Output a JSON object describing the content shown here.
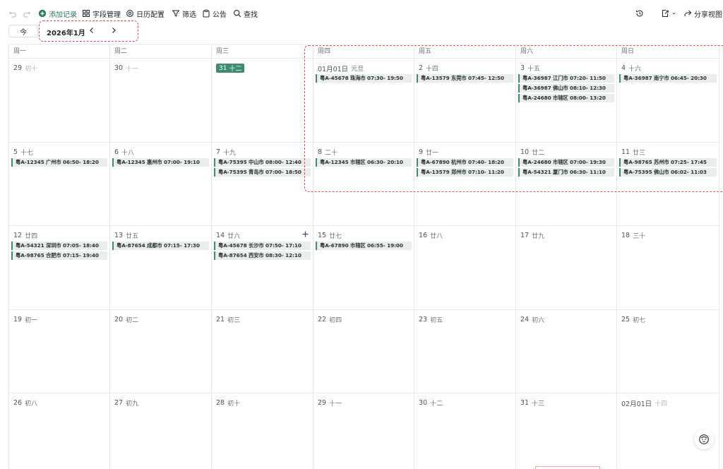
{
  "toolbar": {
    "add_record": "添加记录",
    "field_manage": "字段管理",
    "calendar_config": "日历配置",
    "filter": "筛选",
    "notice": "公告",
    "find": "查找",
    "share_view": "分享视图",
    "accent_color": "#2f7a62"
  },
  "subbar": {
    "today": "今",
    "month": "2026年1月"
  },
  "weekdays": [
    "周一",
    "周二",
    "周三",
    "周四",
    "周五",
    "周六",
    "周日"
  ],
  "weeks": [
    [
      {
        "num": "29",
        "lunar": "初十",
        "dim": true,
        "events": []
      },
      {
        "num": "30",
        "lunar": "十一",
        "dim": true,
        "events": []
      },
      {
        "num": "31",
        "lunar": "十二",
        "today": true,
        "events": []
      },
      {
        "num": "01月01日",
        "lunar": "元旦",
        "events": [
          "粤A-45678 珠海市 07:30- 19:50"
        ]
      },
      {
        "num": "2",
        "lunar": "十四",
        "events": [
          "粤A-13579 东莞市 07:45- 12:50"
        ]
      },
      {
        "num": "3",
        "lunar": "十五",
        "events": [
          "粤A-36987 江门市 07:20- 11:50",
          "粤A-36987 佛山市 08:10- 12:30",
          "粤A-24680 市辖区 08:00- 13:20"
        ]
      },
      {
        "num": "4",
        "lunar": "十六",
        "events": [
          "粤A-36987 南宁市 06:45- 20:30"
        ]
      }
    ],
    [
      {
        "num": "5",
        "lunar": "十七",
        "events": [
          "粤A-12345 广州市 06:50- 18:20"
        ]
      },
      {
        "num": "6",
        "lunar": "十八",
        "events": [
          "粤A-12345 惠州市 07:00- 19:10"
        ]
      },
      {
        "num": "7",
        "lunar": "十九",
        "events": [
          "粤A-75395 中山市 08:00- 12:40",
          "粤A-75395 青岛市 07:00- 18:50"
        ]
      },
      {
        "num": "8",
        "lunar": "二十",
        "events": [
          "粤A-12345 市辖区 06:30- 20:10"
        ]
      },
      {
        "num": "9",
        "lunar": "廿一",
        "events": [
          "粤A-67890 杭州市 07:40- 18:20",
          "粤A-13579 郑州市 07:10- 11:20"
        ]
      },
      {
        "num": "10",
        "lunar": "廿二",
        "events": [
          "粤A-24680 市辖区 07:00- 19:30",
          "粤A-54321 厦门市 06:30- 11:10"
        ]
      },
      {
        "num": "11",
        "lunar": "廿三",
        "events": [
          "粤A-98765 苏州市 07:25- 17:45",
          "粤A-75395 佛山市 06:02- 11:03"
        ]
      }
    ],
    [
      {
        "num": "12",
        "lunar": "廿四",
        "events": [
          "粤A-54321 深圳市 07:05- 18:40",
          "粤A-98765 合肥市 07:15- 19:40"
        ]
      },
      {
        "num": "13",
        "lunar": "廿五",
        "events": [
          "粤A-87654 成都市 07:15- 17:30"
        ]
      },
      {
        "num": "14",
        "lunar": "廿六",
        "add": true,
        "events": [
          "粤A-45678 长沙市 07:50- 17:10",
          "粤A-87654 西安市 08:30- 12:10"
        ]
      },
      {
        "num": "15",
        "lunar": "廿七",
        "events": [
          "粤A-67890 市辖区 06:55- 19:00"
        ]
      },
      {
        "num": "16",
        "lunar": "廿八",
        "events": []
      },
      {
        "num": "17",
        "lunar": "廿九",
        "events": []
      },
      {
        "num": "18",
        "lunar": "三十",
        "events": []
      }
    ],
    [
      {
        "num": "19",
        "lunar": "初一",
        "events": []
      },
      {
        "num": "20",
        "lunar": "初二",
        "events": []
      },
      {
        "num": "21",
        "lunar": "初三",
        "events": []
      },
      {
        "num": "22",
        "lunar": "初四",
        "events": []
      },
      {
        "num": "23",
        "lunar": "初五",
        "events": []
      },
      {
        "num": "24",
        "lunar": "初六",
        "events": []
      },
      {
        "num": "25",
        "lunar": "初七",
        "events": []
      }
    ],
    [
      {
        "num": "26",
        "lunar": "初八",
        "events": []
      },
      {
        "num": "27",
        "lunar": "初九",
        "events": []
      },
      {
        "num": "28",
        "lunar": "初十",
        "events": []
      },
      {
        "num": "29",
        "lunar": "十一",
        "events": []
      },
      {
        "num": "30",
        "lunar": "十二",
        "events": []
      },
      {
        "num": "31",
        "lunar": "十三",
        "events": []
      },
      {
        "num": "02月01日",
        "lunar": "十四",
        "dim": true,
        "events": []
      }
    ]
  ]
}
